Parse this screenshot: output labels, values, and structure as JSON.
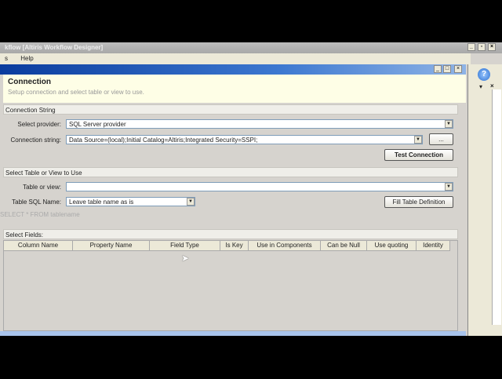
{
  "app": {
    "title": "kflow [Altiris Workflow Designer]",
    "menu": [
      "s",
      "Help"
    ]
  },
  "dialog": {
    "title": "Connection",
    "subtitle": "Setup connection and select table or view to use.",
    "buttons": [
      "_",
      "□",
      "×"
    ]
  },
  "connection": {
    "group": "Connection String",
    "provider_label": "Select provider:",
    "provider_value": "SQL Server provider",
    "conn_label": "Connection string:",
    "conn_value": "Data Source=(local);Initial Catalog=Altiris;Integrated Security=SSPI;",
    "browse_label": "...",
    "test_label": "Test Connection"
  },
  "table": {
    "group": "Select Table or View to Use",
    "table_label": "Table or view:",
    "table_value": "",
    "sqlname_label": "Table SQL Name:",
    "sqlname_value": "Leave table name as is",
    "fill_label": "Fill Table Definition",
    "query": "SELECT * FROM tablename"
  },
  "fields": {
    "group": "Select Fields:",
    "columns": [
      "Column Name",
      "Property Name",
      "Field Type",
      "Is Key",
      "Use in Components",
      "Can be Null",
      "Use quoting",
      "Identity"
    ]
  },
  "right": {
    "help": "?",
    "dropdown": "▾",
    "close": "×"
  }
}
